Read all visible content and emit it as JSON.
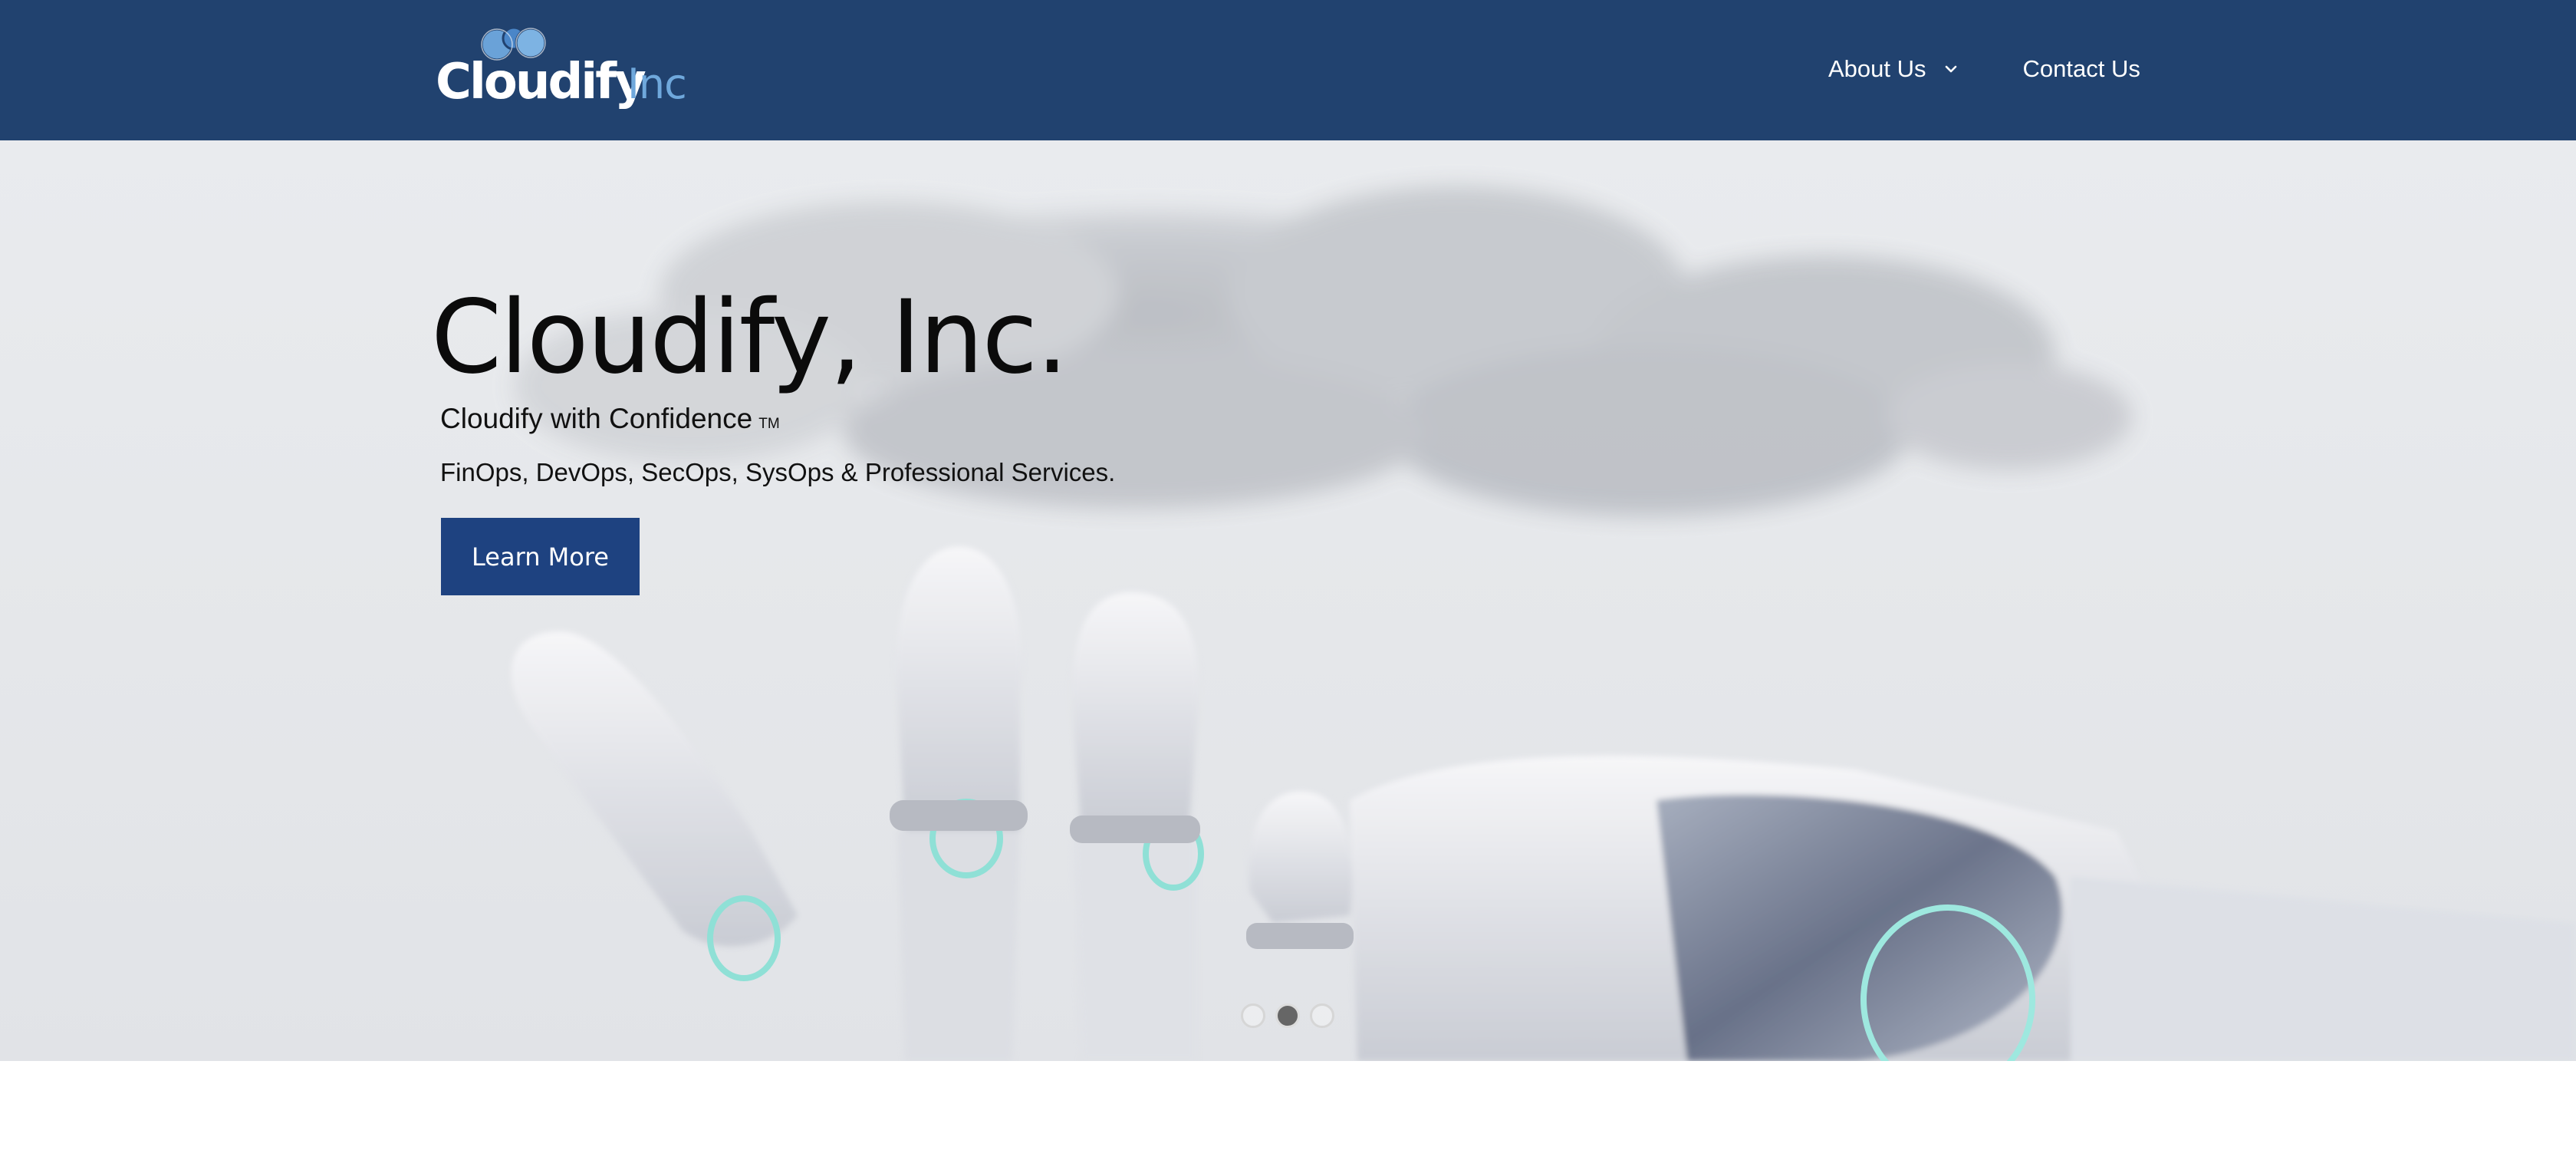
{
  "header": {
    "logo": {
      "wordmark": "Cloudify",
      "suffix": "Inc"
    },
    "nav": [
      {
        "label": "About Us",
        "has_dropdown": true
      },
      {
        "label": "Contact Us",
        "has_dropdown": false
      }
    ]
  },
  "hero": {
    "title": "Cloudify, Inc.",
    "tagline": "Cloudify with Confidence",
    "tagline_mark": "TM",
    "services": "FinOps, DevOps, SecOps, SysOps & Professional Services.",
    "cta_label": "Learn More",
    "slides": {
      "count": 3,
      "active_index": 1
    }
  },
  "colors": {
    "header_bg": "#21426f",
    "cta_bg": "#1e4280",
    "logo_suffix": "#6fa8dc",
    "hero_bg": "#e7e9ec"
  },
  "icons": {
    "logo": "cloud-bubbles-icon",
    "dropdown": "chevron-down-icon"
  }
}
